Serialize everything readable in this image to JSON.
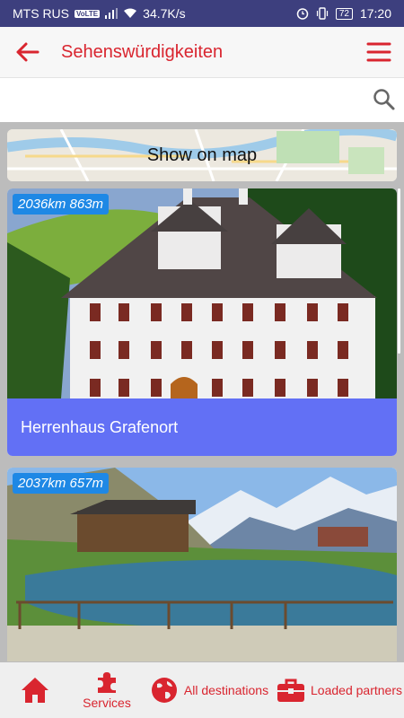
{
  "status_bar": {
    "carrier": "MTS RUS",
    "volte": "VoLTE",
    "speed": "34.7K/s",
    "battery": "72",
    "time": "17:20"
  },
  "app_bar": {
    "title": "Sehenswürdigkeiten"
  },
  "search": {
    "value": "",
    "placeholder": ""
  },
  "map_banner": {
    "label": "Show on map"
  },
  "cards": [
    {
      "distance": "2036km 863m",
      "title": "Herrenhaus Grafenort"
    },
    {
      "distance": "2037km 657m"
    }
  ],
  "bottom_nav": {
    "services": "Services",
    "all_destinations": "All destinations",
    "loaded_partners": "Loaded partners"
  },
  "colors": {
    "brand_red": "#d9252f",
    "status_bar": "#3d3f7e",
    "caption_bg": "#6270f5",
    "badge_bg": "#1e88e5"
  },
  "icons": {
    "back": "arrow-left-icon",
    "menu": "hamburger-menu-icon",
    "search": "search-icon",
    "home": "home-icon",
    "services": "puzzle-icon",
    "all_destinations": "globe-icon",
    "loaded_partners": "briefcase-icon"
  }
}
